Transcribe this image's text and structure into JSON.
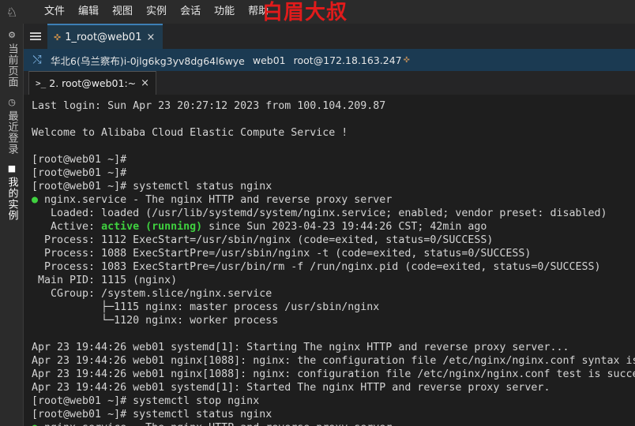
{
  "app": {
    "logo_glyph": "♘"
  },
  "menu": {
    "items": [
      "文件",
      "编辑",
      "视图",
      "实例",
      "会话",
      "功能",
      "帮助"
    ]
  },
  "watermark": {
    "text": "白眉大叔",
    "color": "#e11b1b"
  },
  "sidebar": {
    "tabs": [
      {
        "label": "当前页面",
        "icon": "gear-icon"
      },
      {
        "label": "最近登录",
        "icon": "clock-icon"
      },
      {
        "label": "我的实例",
        "icon": "server-icon"
      }
    ]
  },
  "session_tabs": [
    {
      "label": "1_root@web01",
      "close": "×"
    }
  ],
  "infobar": {
    "region": "华北6(乌兰察布)",
    "instance_id": "i-0jlg6kg3yv8dg64l6wye",
    "host": "web01",
    "user_at_ip": "root@172.18.163.247"
  },
  "terminal_tabs": [
    {
      "label": "2. root@web01:~",
      "close": "×"
    }
  ],
  "terminal": {
    "lines": [
      "Last login: Sun Apr 23 20:27:12 2023 from 100.104.209.87",
      "",
      "Welcome to Alibaba Cloud Elastic Compute Service !",
      "",
      "[root@web01 ~]#",
      "[root@web01 ~]#",
      "[root@web01 ~]# systemctl status nginx",
      "● nginx.service - The nginx HTTP and reverse proxy server",
      "   Loaded: loaded (/usr/lib/systemd/system/nginx.service; enabled; vendor preset: disabled)",
      "   Active: active (running) since Sun 2023-04-23 19:44:26 CST; 42min ago",
      "  Process: 1112 ExecStart=/usr/sbin/nginx (code=exited, status=0/SUCCESS)",
      "  Process: 1088 ExecStartPre=/usr/sbin/nginx -t (code=exited, status=0/SUCCESS)",
      "  Process: 1083 ExecStartPre=/usr/bin/rm -f /run/nginx.pid (code=exited, status=0/SUCCESS)",
      " Main PID: 1115 (nginx)",
      "   CGroup: /system.slice/nginx.service",
      "           ├─1115 nginx: master process /usr/sbin/nginx",
      "           └─1120 nginx: worker process",
      "",
      "Apr 23 19:44:26 web01 systemd[1]: Starting The nginx HTTP and reverse proxy server...",
      "Apr 23 19:44:26 web01 nginx[1088]: nginx: the configuration file /etc/nginx/nginx.conf syntax is ok",
      "Apr 23 19:44:26 web01 nginx[1088]: nginx: configuration file /etc/nginx/nginx.conf test is successful",
      "Apr 23 19:44:26 web01 systemd[1]: Started The nginx HTTP and reverse proxy server.",
      "[root@web01 ~]# systemctl stop nginx",
      "[root@web01 ~]# systemctl status nginx",
      "● nginx.service - The nginx HTTP and reverse proxy server"
    ],
    "highlight": {
      "text": "active (running)",
      "color": "#3fd13f"
    }
  }
}
